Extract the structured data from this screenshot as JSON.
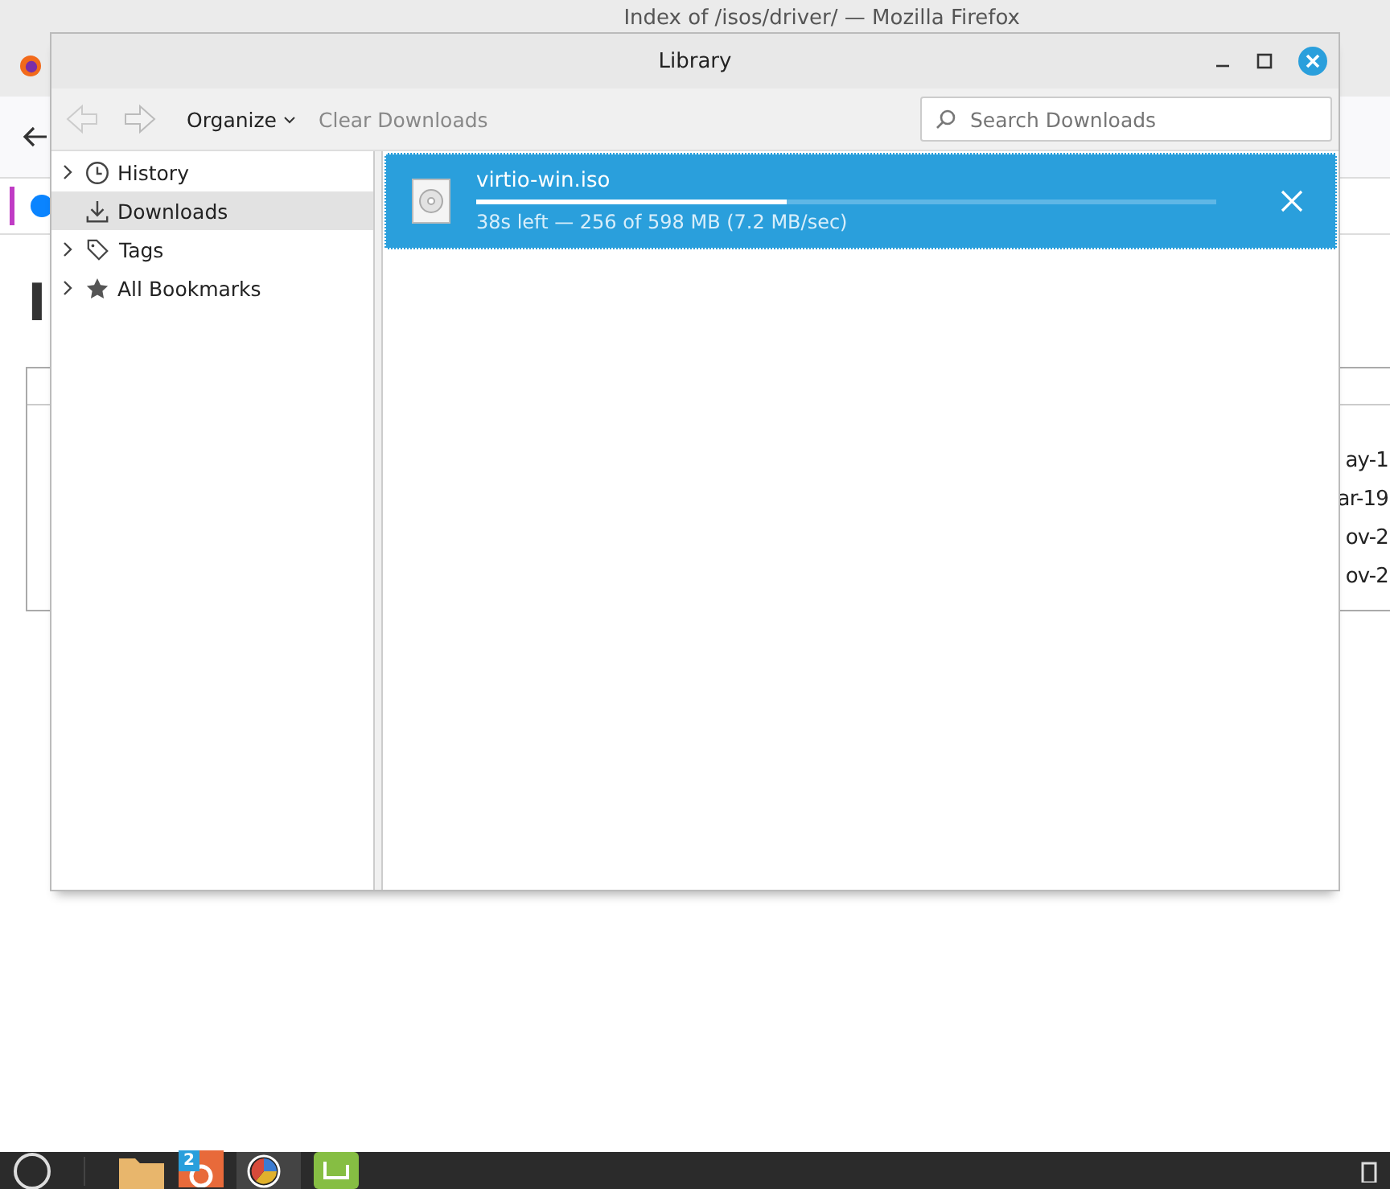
{
  "browser": {
    "title": "Index of /isos/driver/ — Mozilla Firefox",
    "page_heading": "I",
    "date_fragments": [
      "ay-1",
      "ar-19",
      "ov-2",
      "ov-2"
    ]
  },
  "library": {
    "title": "Library",
    "toolbar": {
      "organize": "Organize",
      "clear": "Clear Downloads",
      "search": {
        "placeholder": "Search Downloads"
      }
    },
    "sidebar": [
      {
        "label": "History",
        "kind": "clock",
        "expandable": true,
        "selected": false
      },
      {
        "label": "Downloads",
        "kind": "download",
        "expandable": false,
        "selected": true
      },
      {
        "label": "Tags",
        "kind": "tag",
        "expandable": true,
        "selected": false
      },
      {
        "label": "All Bookmarks",
        "kind": "star",
        "expandable": true,
        "selected": false
      }
    ],
    "downloads": [
      {
        "name": "virtio-win.iso",
        "status": "38s left — 256 of 598 MB (7.2 MB/sec)",
        "level": 0.42,
        "selected": true
      }
    ]
  },
  "taskbar": {
    "badge": "2"
  }
}
